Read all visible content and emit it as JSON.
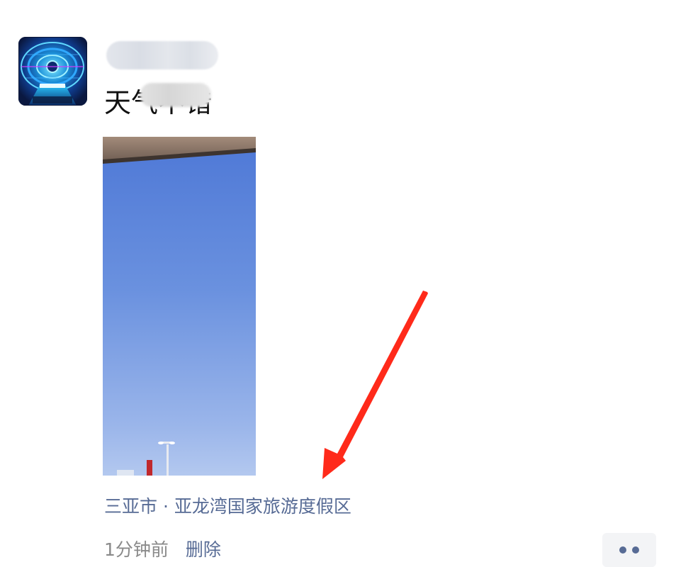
{
  "post": {
    "author_name": "",
    "text": "天气不错",
    "location_text": "三亚市 · 亚龙湾国家旅游度假区",
    "time_text": "1分钟前",
    "delete_label": "删除"
  },
  "icons": {
    "avatar": "avatar-image",
    "more": "more-options-icon",
    "annotation": "red-arrow-annotation"
  },
  "colors": {
    "link": "#576b95",
    "meta_text": "#8a8a8a",
    "body_text": "#111111",
    "arrow": "#ff2a1a",
    "more_button_bg": "#f3f4f6"
  }
}
